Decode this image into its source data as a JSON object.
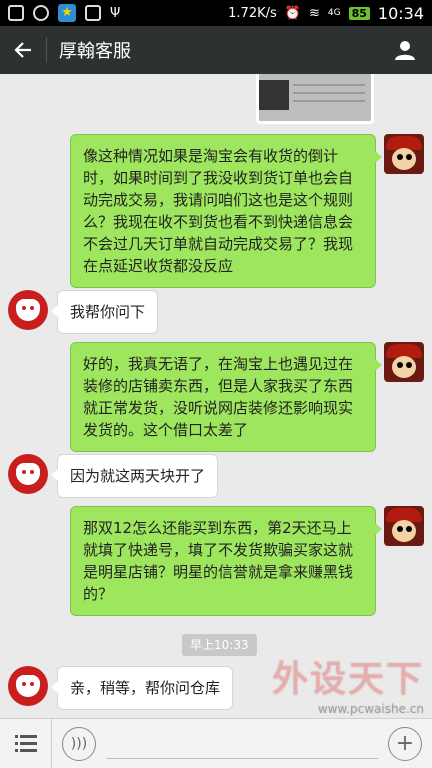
{
  "status_bar": {
    "network_speed": "1.72K/s",
    "network_type": "4G",
    "battery": "85",
    "time": "10:34",
    "icons": [
      "qq-icon",
      "notification-icon",
      "app-icon",
      "signal-icon",
      "usb-icon",
      "alarm-icon",
      "wifi-icon"
    ]
  },
  "header": {
    "back_icon": "arrow-left-icon",
    "title": "厚翰客服",
    "profile_icon": "person-icon"
  },
  "messages": [
    {
      "sender": "me",
      "text": "像这种情况如果是淘宝会有收货的倒计时，如果时间到了我没收到货订单也会自动完成交易，我请问咱们这也是这个规则么？我现在收不到货也看不到快递信息会不会过几天订单就自动完成交易了？我现在点延迟收货都没反应"
    },
    {
      "sender": "them",
      "text": "我帮你问下"
    },
    {
      "sender": "me",
      "text": "好的，我真无语了，在淘宝上也遇见过在装修的店铺卖东西，但是人家我买了东西就正常发货，没听说网店装修还影响现实发货的。这个借口太差了"
    },
    {
      "sender": "them",
      "text": "因为就这两天块开了"
    },
    {
      "sender": "me",
      "text": "那双12怎么还能买到东西，第2天还马上就填了快递号，填了不发货欺骗买家这就是明星店铺？明星的信誉就是拿来赚黑钱的？"
    },
    {
      "sender": "them",
      "text": "亲，稍等，帮你问仓库"
    }
  ],
  "timestamp": "早上10:33",
  "watermark": {
    "title": "外设天下",
    "url": "www.pcwaishe.cn"
  },
  "input_bar": {
    "menu_icon": "menu-list-icon",
    "voice_icon": "voice-icon",
    "text_value": "",
    "plus_icon": "plus-icon"
  },
  "colors": {
    "header_bg": "#2e3132",
    "my_bubble": "#9ee65e",
    "their_bubble": "#ffffff",
    "chat_bg": "#eaeaea",
    "brand_red": "#c81e1e"
  }
}
